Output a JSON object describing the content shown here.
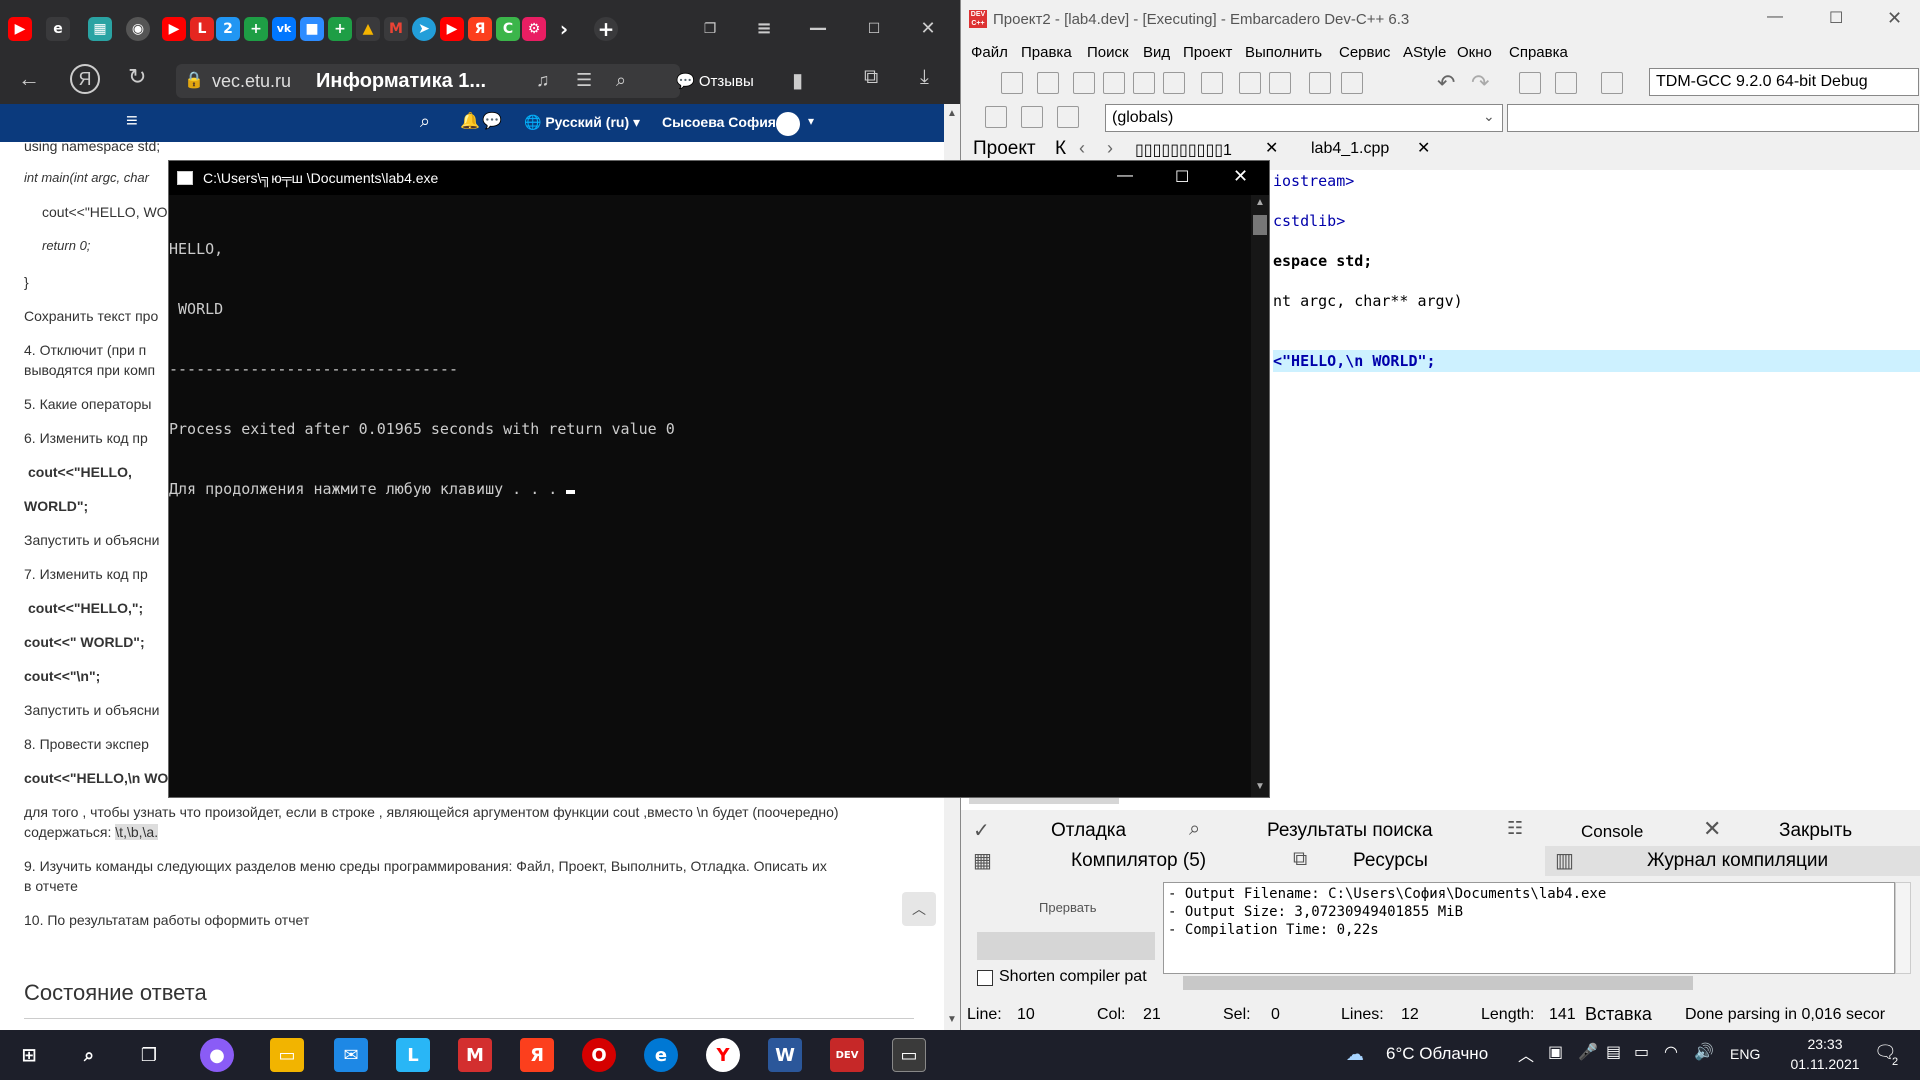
{
  "browser": {
    "domain": "vec.etu.ru",
    "page_title": "Информатика 1...",
    "feedback_label": "Отзывы",
    "nav": {
      "language": "Русский (ru)",
      "user": "Сысоева София"
    },
    "content": {
      "code_lines": [
        "using namespace std;",
        "int main(int argc, char",
        "cout<<\"HELLO, WO",
        "return 0;",
        "}"
      ],
      "items": [
        {
          "text": "Сохранить текст про"
        },
        {
          "text": "4.    Отключит (при п"
        },
        {
          "text": "выводятся при комп"
        },
        {
          "text": "5.    Какие операторы"
        },
        {
          "text": "6.    Изменить код пр"
        },
        {
          "text": "cout<<\"HELLO,"
        },
        {
          "text": "WORLD\";"
        },
        {
          "text": "Запустить и объясни"
        },
        {
          "text": "7.    Изменить код пр"
        },
        {
          "text": "cout<<\"HELLO,\";"
        },
        {
          "text": "cout<<\" WORLD\";"
        },
        {
          "text": "cout<<\"\\n\";"
        },
        {
          "text": "Запустить и объясни"
        },
        {
          "text": "8.    Провести экспер"
        },
        {
          "text": "cout<<\"HELLO,\\n WO"
        }
      ],
      "para_item8_line1": "для того , чтобы узнать что произойдет, если в строке , являющейся аргументом функции cout ,вместо \\n будет (поочередно)",
      "para_item8_line2_prefix": "содержаться: ",
      "para_item8_highlight": "\\t,\\b,\\a.",
      "item9_line1": "9.    Изучить команды следующих разделов меню среды программирования: Файл, Проект, Выполнить, Отладка. Описать их",
      "item9_line2": "в отчете",
      "item10": "10.   По результатам работы оформить отчет",
      "section_heading": "Состояние ответа"
    }
  },
  "console": {
    "title": "C:\\Users\\╗ю╤ш \\Documents\\lab4.exe",
    "lines": [
      "HELLO,",
      " WORLD",
      "--------------------------------",
      "Process exited after 0.01965 seconds with return value 0",
      "Для продолжения нажмите любую клавишу . . ."
    ]
  },
  "devcpp": {
    "title": "Проект2 - [lab4.dev] - [Executing] - Embarcadero Dev-C++ 6.3",
    "menu": [
      "Файл",
      "Правка",
      "Поиск",
      "Вид",
      "Проект",
      "Выполнить",
      "Сервис",
      "AStyle",
      "Окно",
      "Справка"
    ],
    "compiler_select": "TDM-GCC 9.2.0 64-bit Debug",
    "scope_select": "(globals)",
    "left_tabs": [
      "Проект",
      "К"
    ],
    "file_tab_garbled": "▯▯▯▯▯▯▯▯▯▯1",
    "file_tab": "lab4_1.cpp",
    "code_lines": [
      {
        "text": "iostream>",
        "highlight": false
      },
      {
        "text": "cstdlib>",
        "highlight": false
      },
      {
        "text": "espace std;",
        "highlight": false
      },
      {
        "text": "nt argc, char** argv)",
        "highlight": false
      },
      {
        "text": "<\"HELLO,\\n WORLD\";",
        "highlight": true
      }
    ],
    "bottom_tabs": {
      "row1": [
        "Отладка",
        "Результаты поиска",
        "Console",
        "Закрыть"
      ],
      "row2": [
        "Компилятор (5)",
        "Ресурсы",
        "Журнал компиляции"
      ]
    },
    "abort_label": "Прервать",
    "shorten_label": "Shorten compiler pat",
    "log_lines": [
      "- Output Filename: C:\\Users\\София\\Documents\\lab4.exe",
      "- Output Size: 3,07230949401855 MiB",
      "- Compilation Time: 0,22s"
    ],
    "status": {
      "line_label": "Line:",
      "line": "10",
      "col_label": "Col:",
      "col": "21",
      "sel_label": "Sel:",
      "sel": "0",
      "lines_label": "Lines:",
      "lines": "12",
      "length_label": "Length:",
      "length": "141",
      "mode": "Вставка",
      "parse": "Done parsing in 0,016 secor"
    }
  },
  "taskbar": {
    "weather": "6°C Облачно",
    "lang": "ENG",
    "time": "23:33",
    "date": "01.11.2021",
    "notifications": "2"
  }
}
